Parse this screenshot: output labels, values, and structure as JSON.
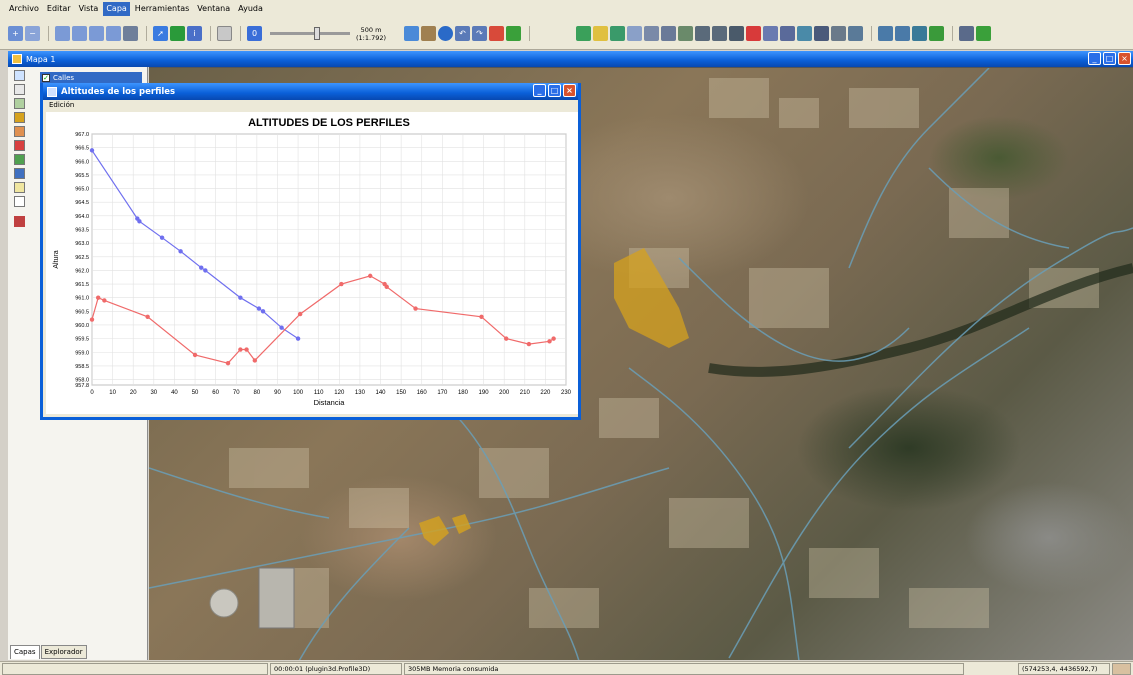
{
  "menu": {
    "items": [
      "Archivo",
      "Editar",
      "Vista",
      "Capa",
      "Herramientas",
      "Ventana",
      "Ayuda"
    ],
    "active_index": 3
  },
  "toolbar": {
    "scale_line1": "500 m",
    "scale_line2": "(1:1.792)",
    "slider_level": 0.6
  },
  "map_window": {
    "title": "Mapa 1"
  },
  "toc": {
    "layer_name": "Calles",
    "tabs": [
      "Capas",
      "Explorador"
    ],
    "active_tab_index": 0
  },
  "profile_window": {
    "title": "Altitudes de los perfiles",
    "menu_label": "Edición"
  },
  "chart_data": {
    "type": "line",
    "title": "ALTITUDES DE LOS PERFILES",
    "xlabel": "Distancia",
    "ylabel": "Altura",
    "xlim": [
      0,
      230
    ],
    "ylim": [
      957.8,
      967.0
    ],
    "x_ticks": [
      0,
      10,
      20,
      30,
      40,
      50,
      60,
      70,
      80,
      90,
      100,
      110,
      120,
      130,
      140,
      150,
      160,
      170,
      180,
      190,
      200,
      210,
      220,
      230
    ],
    "y_ticks": [
      957.8,
      958.0,
      958.5,
      959.0,
      959.5,
      960.0,
      960.5,
      961.0,
      961.5,
      962.0,
      962.5,
      963.0,
      963.5,
      964.0,
      964.5,
      965.0,
      965.5,
      966.0,
      966.5,
      967.0
    ],
    "grid": true,
    "series": [
      {
        "color": "#6f6fef",
        "points": [
          [
            0,
            966.4
          ],
          [
            22,
            963.9
          ],
          [
            23,
            963.8
          ],
          [
            34,
            963.2
          ],
          [
            43,
            962.7
          ],
          [
            53,
            962.1
          ],
          [
            55,
            962.0
          ],
          [
            72,
            961.0
          ],
          [
            81,
            960.6
          ],
          [
            83,
            960.5
          ],
          [
            92,
            959.9
          ],
          [
            100,
            959.5
          ]
        ]
      },
      {
        "color": "#f06a6a",
        "points": [
          [
            0,
            960.2
          ],
          [
            3,
            961.0
          ],
          [
            6,
            960.9
          ],
          [
            27,
            960.3
          ],
          [
            50,
            958.9
          ],
          [
            66,
            958.6
          ],
          [
            72,
            959.1
          ],
          [
            75,
            959.1
          ],
          [
            79,
            958.7
          ],
          [
            101,
            960.4
          ],
          [
            121,
            961.5
          ],
          [
            135,
            961.8
          ],
          [
            142,
            961.5
          ],
          [
            143,
            961.4
          ],
          [
            157,
            960.6
          ],
          [
            189,
            960.3
          ],
          [
            201,
            959.5
          ],
          [
            212,
            959.3
          ],
          [
            222,
            959.4
          ],
          [
            224,
            959.5
          ]
        ]
      }
    ]
  },
  "status": {
    "timer": "00:00:01 (plugin3d.Profile3D)",
    "memory": "305MB Memoria consumida",
    "coordinates": "(574253,4, 4436592,7)"
  },
  "colors": {
    "title_bar": "#0a5fd8",
    "selection": "#316ac5",
    "footprint": "#d6a21e",
    "roads": "#6a9fb8"
  }
}
